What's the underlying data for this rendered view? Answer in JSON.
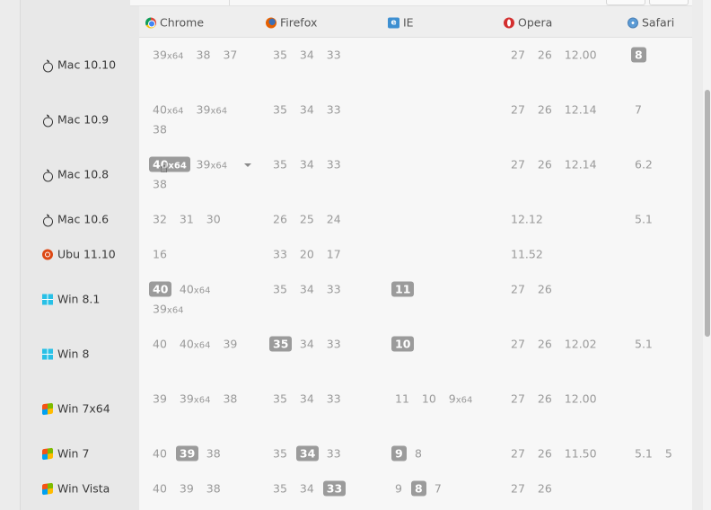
{
  "browsers": [
    {
      "key": "chrome",
      "label": "Chrome",
      "icon": "chrome-icon"
    },
    {
      "key": "firefox",
      "label": "Firefox",
      "icon": "firefox-icon"
    },
    {
      "key": "ie",
      "label": "IE",
      "icon": "ie-icon"
    },
    {
      "key": "opera",
      "label": "Opera",
      "icon": "opera-icon"
    },
    {
      "key": "safari",
      "label": "Safari",
      "icon": "safari-icon"
    }
  ],
  "rows": [
    {
      "os": "Mac 10.10",
      "icon": "apple-icon",
      "chrome": [
        {
          "v": "39",
          "s": "x64"
        },
        {
          "v": "38"
        },
        {
          "v": "37"
        }
      ],
      "firefox": [
        {
          "v": "35"
        },
        {
          "v": "34"
        },
        {
          "v": "33"
        }
      ],
      "ie": [],
      "opera": [
        {
          "v": "27"
        },
        {
          "v": "26"
        },
        {
          "v": "12.00"
        }
      ],
      "safari": [
        {
          "v": "8",
          "hl": true
        }
      ]
    },
    {
      "os": "Mac 10.9",
      "icon": "apple-icon",
      "chrome": [
        {
          "v": "40",
          "s": "x64"
        },
        {
          "v": "39",
          "s": "x64"
        },
        {
          "v": "38"
        }
      ],
      "firefox": [
        {
          "v": "35"
        },
        {
          "v": "34"
        },
        {
          "v": "33"
        }
      ],
      "ie": [],
      "opera": [
        {
          "v": "27"
        },
        {
          "v": "26"
        },
        {
          "v": "12.14"
        }
      ],
      "safari": [
        {
          "v": "7"
        }
      ]
    },
    {
      "os": "Mac 10.8",
      "icon": "apple-icon",
      "chrome": [
        {
          "v": "40",
          "s": "x64",
          "hl": true
        },
        {
          "v": "39",
          "s": "x64"
        },
        {
          "v": "38"
        }
      ],
      "firefox": [
        {
          "v": "35"
        },
        {
          "v": "34"
        },
        {
          "v": "33"
        }
      ],
      "ie": [],
      "opera": [
        {
          "v": "27"
        },
        {
          "v": "26"
        },
        {
          "v": "12.14"
        }
      ],
      "safari": [
        {
          "v": "6.2"
        }
      ]
    },
    {
      "os": "Mac 10.6",
      "icon": "apple-icon",
      "chrome": [
        {
          "v": "32"
        },
        {
          "v": "31"
        },
        {
          "v": "30"
        }
      ],
      "firefox": [
        {
          "v": "26"
        },
        {
          "v": "25"
        },
        {
          "v": "24"
        }
      ],
      "ie": [],
      "opera": [
        {
          "v": "12.12"
        }
      ],
      "safari": [
        {
          "v": "5.1"
        }
      ]
    },
    {
      "os": "Ubu 11.10",
      "icon": "ubuntu-icon",
      "chrome": [
        {
          "v": "16"
        }
      ],
      "firefox": [
        {
          "v": "33"
        },
        {
          "v": "20"
        },
        {
          "v": "17"
        }
      ],
      "ie": [],
      "opera": [
        {
          "v": "11.52"
        }
      ],
      "safari": []
    },
    {
      "os": "Win 8.1",
      "icon": "windows8-icon",
      "chrome": [
        {
          "v": "40",
          "hl": true
        },
        {
          "v": "40",
          "s": "x64"
        },
        {
          "v": "39",
          "s": "x64"
        }
      ],
      "firefox": [
        {
          "v": "35"
        },
        {
          "v": "34"
        },
        {
          "v": "33"
        }
      ],
      "ie": [
        {
          "v": "11",
          "hl": true
        }
      ],
      "opera": [
        {
          "v": "27"
        },
        {
          "v": "26"
        }
      ],
      "safari": []
    },
    {
      "os": "Win 8",
      "icon": "windows8-icon",
      "chrome": [
        {
          "v": "40"
        },
        {
          "v": "40",
          "s": "x64"
        },
        {
          "v": "39"
        }
      ],
      "firefox": [
        {
          "v": "35",
          "hl": true
        },
        {
          "v": "34"
        },
        {
          "v": "33"
        }
      ],
      "ie": [
        {
          "v": "10",
          "hl": true
        }
      ],
      "opera": [
        {
          "v": "27"
        },
        {
          "v": "26"
        },
        {
          "v": "12.02"
        }
      ],
      "safari": [
        {
          "v": "5.1"
        }
      ]
    },
    {
      "os": "Win 7x64",
      "icon": "windows-icon",
      "chrome": [
        {
          "v": "39"
        },
        {
          "v": "39",
          "s": "x64"
        },
        {
          "v": "38"
        }
      ],
      "firefox": [
        {
          "v": "35"
        },
        {
          "v": "34"
        },
        {
          "v": "33"
        }
      ],
      "ie": [
        {
          "v": "11"
        },
        {
          "v": "10"
        },
        {
          "v": "9",
          "s": "x64"
        }
      ],
      "opera": [
        {
          "v": "27"
        },
        {
          "v": "26"
        },
        {
          "v": "12.00"
        }
      ],
      "safari": []
    },
    {
      "os": "Win 7",
      "icon": "windows-icon",
      "chrome": [
        {
          "v": "40"
        },
        {
          "v": "39",
          "hl": true
        },
        {
          "v": "38"
        }
      ],
      "firefox": [
        {
          "v": "35"
        },
        {
          "v": "34",
          "hl": true
        },
        {
          "v": "33"
        }
      ],
      "ie": [
        {
          "v": "9",
          "hl": true
        },
        {
          "v": "8"
        }
      ],
      "opera": [
        {
          "v": "27"
        },
        {
          "v": "26"
        },
        {
          "v": "11.50"
        }
      ],
      "safari": [
        {
          "v": "5.1"
        },
        {
          "v": "5"
        }
      ]
    },
    {
      "os": "Win Vista",
      "icon": "windows-icon",
      "chrome": [
        {
          "v": "40"
        },
        {
          "v": "39"
        },
        {
          "v": "38"
        }
      ],
      "firefox": [
        {
          "v": "35"
        },
        {
          "v": "34"
        },
        {
          "v": "33",
          "hl": true
        }
      ],
      "ie": [
        {
          "v": "9"
        },
        {
          "v": "8",
          "hl": true
        },
        {
          "v": "7"
        }
      ],
      "opera": [
        {
          "v": "27"
        },
        {
          "v": "26"
        }
      ],
      "safari": []
    }
  ]
}
